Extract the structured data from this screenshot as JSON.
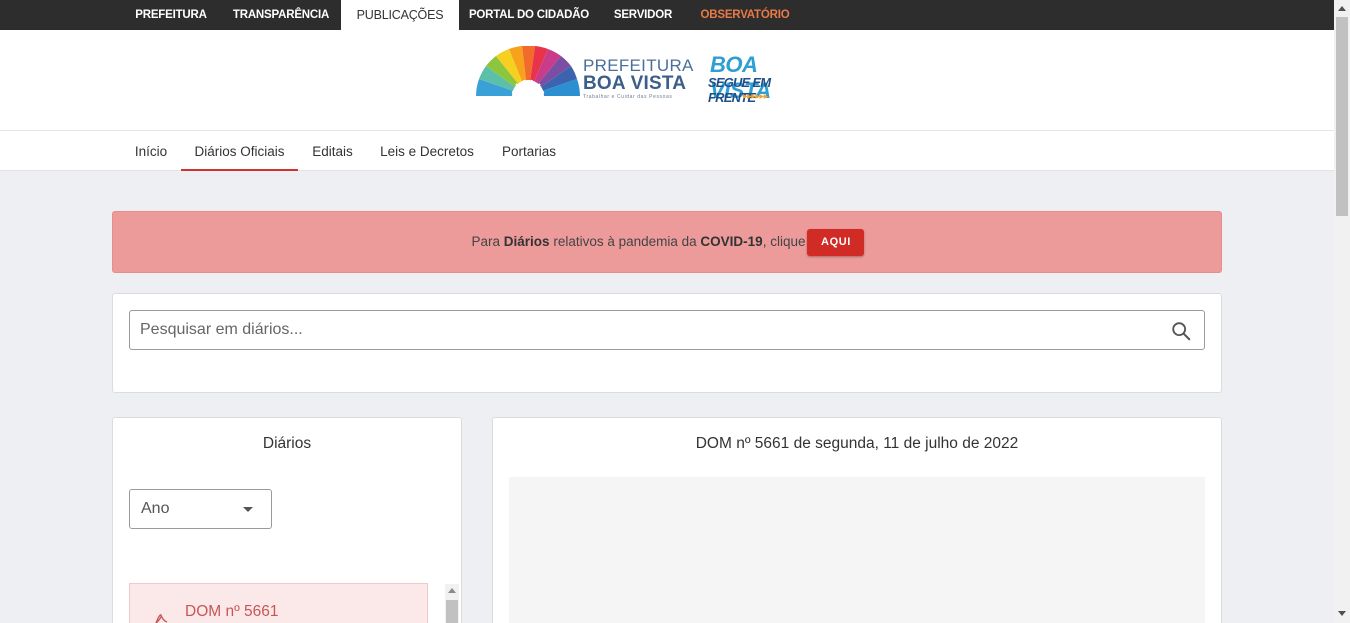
{
  "topnav": {
    "items": [
      {
        "label": "PREFEITURA"
      },
      {
        "label": "TRANSPARÊNCIA"
      },
      {
        "label": "PUBLICAÇÕES"
      },
      {
        "label": "PORTAL DO CIDADÃO"
      },
      {
        "label": "SERVIDOR"
      },
      {
        "label": "OBSERVATÓRIO"
      }
    ],
    "active": "PUBLICAÇÕES",
    "highlight_color": "#e87a48"
  },
  "logo": {
    "line1": "PREFEITURA",
    "line2": "BOA VISTA",
    "tagline": "Trabalhar e Cuidar das Pessoas"
  },
  "logo2": {
    "line1": "BOA VISTA",
    "line2": "SEGUE EM FRENTE",
    "arrows": "▶▶▶▶▶▶"
  },
  "subnav": {
    "items": [
      {
        "label": "Início"
      },
      {
        "label": "Diários Oficiais"
      },
      {
        "label": "Editais"
      },
      {
        "label": "Leis e Decretos"
      },
      {
        "label": "Portarias"
      }
    ],
    "active": "Diários Oficiais",
    "active_color": "#d0322f"
  },
  "alert": {
    "text_before": "Para ",
    "bold1": "Diários",
    "text_middle": " relativos à pandemia da ",
    "bold2": "COVID-19",
    "text_after": ", clique",
    "button_label": "AQUI",
    "background": "#ed9a9a",
    "button_color": "#d12b26"
  },
  "search": {
    "placeholder": "Pesquisar em diários...",
    "value": ""
  },
  "diarios_panel": {
    "title": "Diários",
    "year_select": {
      "value": "Ano"
    },
    "items": [
      {
        "label": "DOM nº 5661"
      }
    ]
  },
  "viewer_panel": {
    "title": "DOM nº 5661 de segunda, 11 de julho de 2022"
  }
}
